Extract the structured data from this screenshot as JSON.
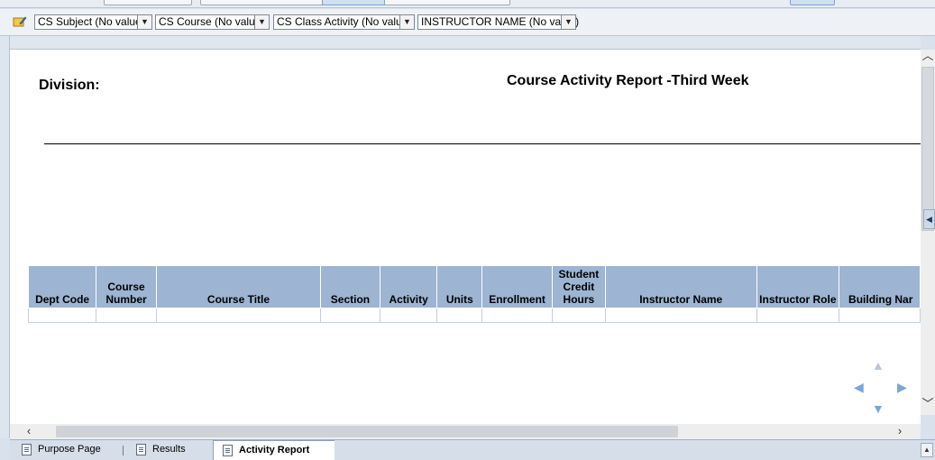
{
  "prompts": [
    {
      "label": "CS Subject (No value)"
    },
    {
      "label": "CS Course (No value)"
    },
    {
      "label": "CS Class Activity (No value)"
    },
    {
      "label": "INSTRUCTOR NAME (No value)"
    }
  ],
  "report": {
    "division_label": "Division:",
    "title": "Course Activity Report -Third Week",
    "columns": [
      {
        "label": "Dept Code"
      },
      {
        "label": "Course Number"
      },
      {
        "label": "Course Title"
      },
      {
        "label": "Section"
      },
      {
        "label": "Activity"
      },
      {
        "label": "Units"
      },
      {
        "label": "Enrollment"
      },
      {
        "label": "Student Credit Hours"
      },
      {
        "label": "Instructor Name"
      },
      {
        "label": "Instructor Role"
      },
      {
        "label": "Building Nar"
      }
    ]
  },
  "tabs": [
    {
      "label": "Purpose Page"
    },
    {
      "label": "Results"
    },
    {
      "label": "Activity Report"
    }
  ],
  "colors": {
    "table_header": "#9db4d2",
    "nav_arrow": "#79a5d8"
  }
}
